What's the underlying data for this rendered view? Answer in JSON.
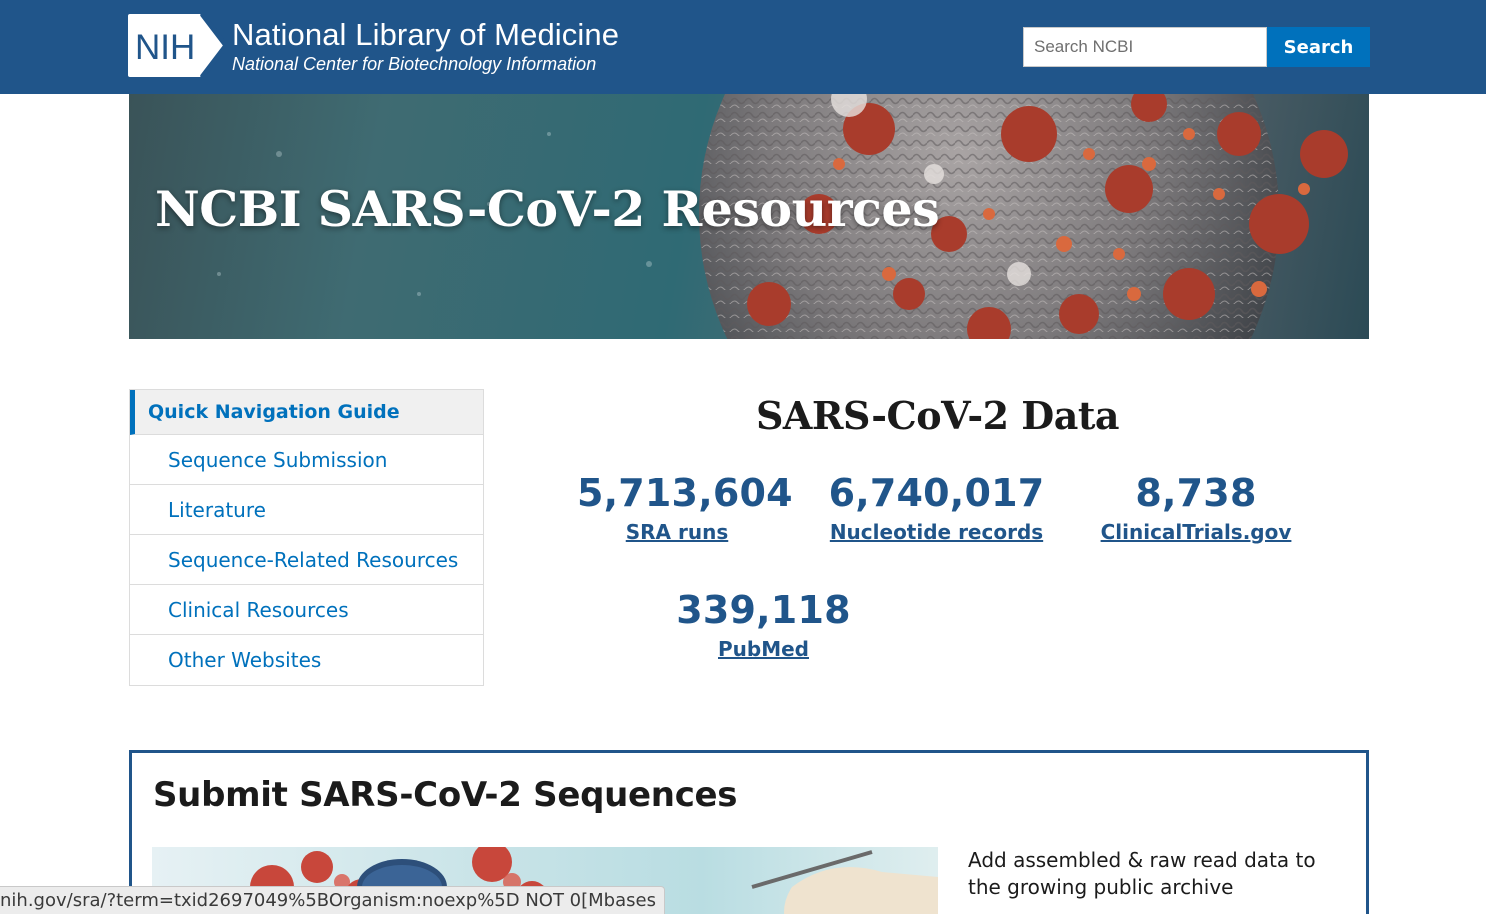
{
  "header": {
    "logo_badge": "NIH",
    "title": "National Library of Medicine",
    "subtitle": "National Center for Biotechnology Information",
    "search_placeholder": "Search NCBI",
    "search_button": "Search",
    "bg_color": "#20558a",
    "accent_color": "#0071bc"
  },
  "hero": {
    "title": "NCBI SARS-CoV-2 Resources"
  },
  "quick_nav": {
    "heading": "Quick Navigation Guide",
    "items": [
      {
        "label": "Sequence Submission"
      },
      {
        "label": "Literature"
      },
      {
        "label": "Sequence-Related Resources"
      },
      {
        "label": "Clinical Resources"
      },
      {
        "label": "Other Websites"
      }
    ]
  },
  "data_section": {
    "title": "SARS-CoV-2 Data",
    "stats": [
      {
        "value": "5,713,604",
        "label": "SRA runs"
      },
      {
        "value": "6,740,017",
        "label": "Nucleotide records"
      },
      {
        "value": "8,738",
        "label": "ClinicalTrials.gov"
      },
      {
        "value": "339,118",
        "label": "PubMed"
      }
    ]
  },
  "submit": {
    "title": "Submit SARS-CoV-2 Sequences",
    "description": "Add assembled & raw read data to the growing public archive"
  },
  "status_bar": {
    "url": "nih.gov/sra/?term=txid2697049%5BOrganism:noexp%5D NOT 0[Mbases"
  }
}
